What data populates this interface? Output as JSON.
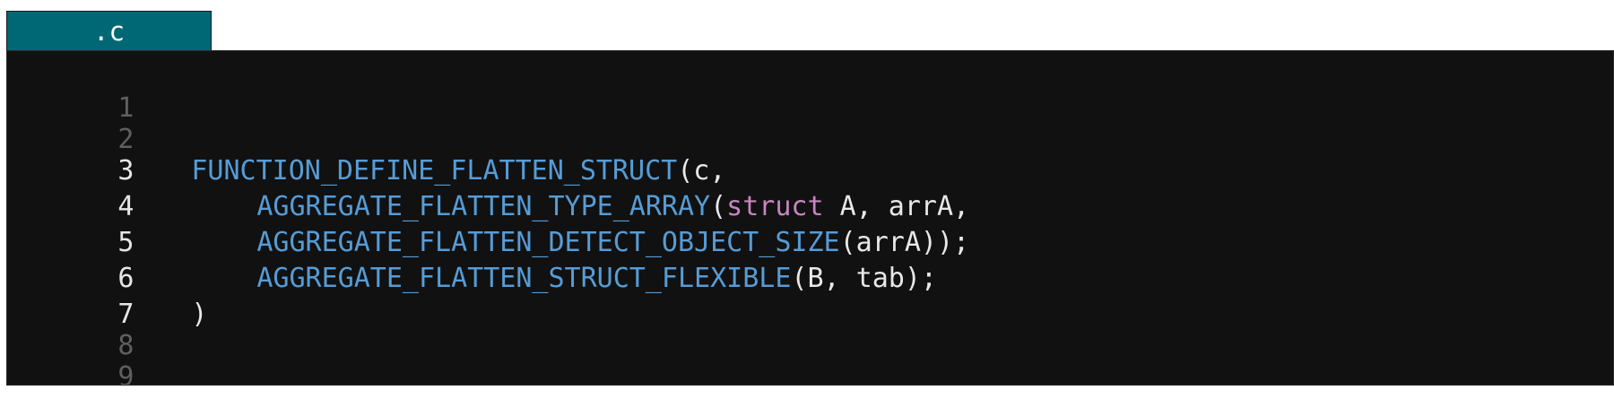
{
  "tab": {
    "label": ".c"
  },
  "editor": {
    "lines": [
      {
        "number": "1"
      },
      {
        "number": "2"
      },
      {
        "number": "3",
        "fn": "FUNCTION_DEFINE_FLATTEN_STRUCT",
        "rest": "(c,"
      },
      {
        "number": "4",
        "fn": "AGGREGATE_FLATTEN_TYPE_ARRAY",
        "open": "(",
        "kw": "struct",
        "rest": " A, arrA,"
      },
      {
        "number": "5",
        "fn": "AGGREGATE_FLATTEN_DETECT_OBJECT_SIZE",
        "rest": "(arrA));"
      },
      {
        "number": "6",
        "fn": "AGGREGATE_FLATTEN_STRUCT_FLEXIBLE",
        "rest": "(B, tab);"
      },
      {
        "number": "7",
        "rest": ")"
      },
      {
        "number": "8"
      },
      {
        "number": "9"
      }
    ]
  },
  "colors": {
    "tab_background": "#006874",
    "editor_background": "#111111",
    "function_name": "#569cd6",
    "keyword": "#c586c0",
    "text": "#e8e8e8",
    "line_number_dim": "#5f5f5f",
    "line_number_active": "#e6e6e6"
  }
}
